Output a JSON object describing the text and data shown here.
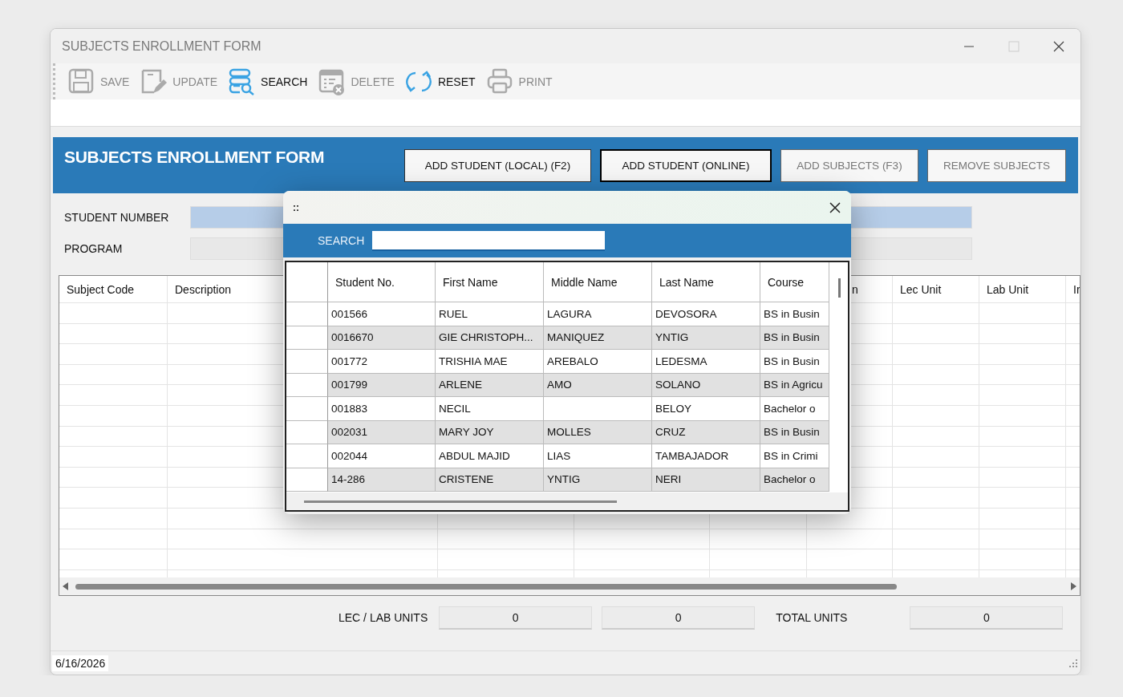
{
  "window": {
    "title": "SUBJECTS ENROLLMENT FORM",
    "maximize_disabled": true
  },
  "toolbar": [
    {
      "kind": "save",
      "label": "SAVE",
      "disabled": true
    },
    {
      "kind": "update",
      "label": "UPDATE",
      "disabled": true
    },
    {
      "kind": "search",
      "label": "SEARCH",
      "disabled": false
    },
    {
      "kind": "delete",
      "label": "DELETE",
      "disabled": true
    },
    {
      "kind": "reset",
      "label": "RESET",
      "disabled": false
    },
    {
      "kind": "print",
      "label": "PRINT",
      "disabled": true
    }
  ],
  "header": {
    "title": "SUBJECTS ENROLLMENT FORM",
    "buttons": [
      {
        "label": "ADD STUDENT (LOCAL) (F2)",
        "focused": false,
        "disabled": false
      },
      {
        "label": "ADD STUDENT (ONLINE)",
        "focused": true,
        "disabled": false
      },
      {
        "label": "ADD SUBJECTS (F3)",
        "focused": false,
        "disabled": true
      },
      {
        "label": "REMOVE SUBJECTS",
        "focused": false,
        "disabled": true
      }
    ]
  },
  "form": {
    "fields": [
      {
        "label": "STUDENT NUMBER",
        "focused": true
      },
      {
        "label": "PROGRAM",
        "focused": false
      }
    ]
  },
  "subjects_grid": {
    "columns": [
      "Subject Code",
      "Description",
      "n",
      "Lec Unit",
      "Lab Unit",
      "Ir"
    ]
  },
  "units": {
    "lec_lab_label": "LEC / LAB UNITS",
    "lec": "0",
    "lab": "0",
    "total_label": "TOTAL UNITS",
    "total": "0"
  },
  "status_bar": {
    "date": "6/16/2026"
  },
  "lookup_dialog": {
    "grip": "::",
    "search_label": "SEARCH",
    "columns": [
      "Student No.",
      "First Name",
      "Middle Name",
      "Last Name",
      "Course"
    ],
    "rows": [
      [
        "001566",
        "RUEL",
        "LAGURA",
        "DEVOSORA",
        "BS in Busin"
      ],
      [
        "0016670",
        "GIE CHRISTOPH...",
        "MANIQUEZ",
        "YNTIG",
        "BS in Busin"
      ],
      [
        "001772",
        "TRISHIA MAE",
        "AREBALO",
        "LEDESMA",
        "BS in Busin"
      ],
      [
        "001799",
        "ARLENE",
        "AMO",
        "SOLANO",
        "BS in Agricu"
      ],
      [
        "001883",
        "NECIL",
        "",
        "BELOY",
        "Bachelor o"
      ],
      [
        "002031",
        "MARY JOY",
        "MOLLES",
        "CRUZ",
        "BS in Busin"
      ],
      [
        "002044",
        "ABDUL MAJID",
        "LIAS",
        "TAMBAJADOR",
        "BS in Crimi"
      ],
      [
        "14-286",
        "CRISTENE",
        "YNTIG",
        "NERI",
        "Bachelor o"
      ]
    ]
  }
}
